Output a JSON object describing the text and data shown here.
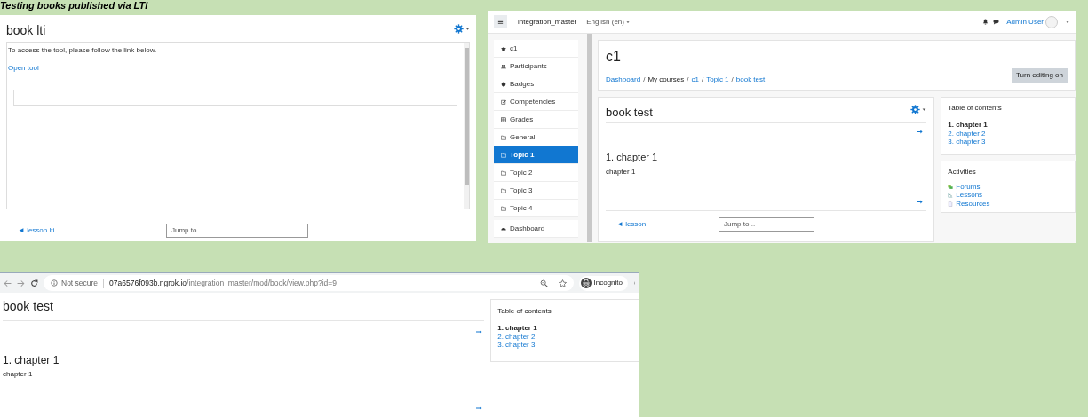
{
  "caption": "Testing books published via LTI",
  "lti_panel": {
    "title": "book lti",
    "message": "To access the tool, please follow the link below.",
    "link": "Open tool",
    "prev_link": "◄ lesson lti",
    "jump_select": "Jump to..."
  },
  "moodle_panel": {
    "site_name": "integration_master",
    "language": "English (en)",
    "user": "Admin User",
    "sidebar": [
      {
        "items": [
          {
            "label": "c1",
            "selected": false
          },
          {
            "label": "Participants",
            "selected": false
          },
          {
            "label": "Badges",
            "selected": false
          },
          {
            "label": "Competencies",
            "selected": false
          },
          {
            "label": "Grades",
            "selected": false
          },
          {
            "label": "General",
            "selected": false
          },
          {
            "label": "Topic 1",
            "selected": true
          },
          {
            "label": "Topic 2",
            "selected": false
          },
          {
            "label": "Topic 3",
            "selected": false
          },
          {
            "label": "Topic 4",
            "selected": false
          }
        ]
      },
      {
        "items": [
          {
            "label": "Dashboard",
            "selected": false
          }
        ]
      }
    ],
    "course_title": "c1",
    "breadcrumb_separator": "/",
    "breadcrumb": [
      {
        "label": "Dashboard",
        "link": true
      },
      {
        "label": "My courses",
        "link": false
      },
      {
        "label": "c1",
        "link": true
      },
      {
        "label": "Topic 1",
        "link": true
      },
      {
        "label": "book test",
        "link": true
      }
    ],
    "edit_button": "Turn editing on",
    "book_title": "book test",
    "chapter_heading": "1. chapter 1",
    "chapter_text": "chapter 1",
    "prev_link": "◄ lesson",
    "jump_select": "Jump to...",
    "toc": {
      "title": "Table of contents",
      "items": [
        {
          "label": "1. chapter 1",
          "selected": true
        },
        {
          "label": "2. chapter 2",
          "selected": false
        },
        {
          "label": "3. chapter 3",
          "selected": false
        }
      ]
    },
    "activities": {
      "title": "Activities",
      "items": [
        {
          "label": "Forums"
        },
        {
          "label": "Lessons"
        },
        {
          "label": "Resources"
        }
      ]
    }
  },
  "browser_panel": {
    "security": "Not secure",
    "url_host": "07a6576f093b.ngrok.io",
    "url_path": "/integration_master/mod/book/view.php?id=9",
    "incognito": "Incognito",
    "book_title": "book test",
    "chapter_heading": "1. chapter 1",
    "chapter_text": "chapter 1",
    "toc": {
      "title": "Table of contents",
      "items": [
        {
          "label": "1. chapter 1",
          "selected": true
        },
        {
          "label": "2. chapter 2",
          "selected": false
        },
        {
          "label": "3. chapter 3",
          "selected": false
        }
      ]
    }
  }
}
